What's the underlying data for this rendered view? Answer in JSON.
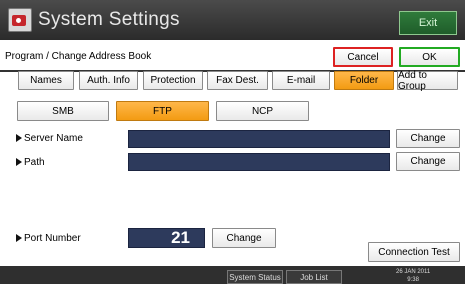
{
  "header": {
    "title": "System Settings",
    "exit_label": "Exit"
  },
  "sub_header": {
    "page_label": "Program / Change Address Book",
    "cancel_label": "Cancel",
    "ok_label": "OK"
  },
  "tabs": {
    "items": [
      {
        "label": "Names"
      },
      {
        "label": "Auth. Info"
      },
      {
        "label": "Protection"
      },
      {
        "label": "Fax Dest."
      },
      {
        "label": "E-mail"
      },
      {
        "label": "Folder"
      },
      {
        "label": "Add to Group"
      }
    ],
    "selected": "Folder"
  },
  "protocol": {
    "items": [
      {
        "label": "SMB"
      },
      {
        "label": "FTP"
      },
      {
        "label": "NCP"
      }
    ],
    "selected": "FTP"
  },
  "fields": {
    "server_name": {
      "label": "Server Name",
      "value": "",
      "change_label": "Change"
    },
    "path": {
      "label": "Path",
      "value": "",
      "change_label": "Change"
    },
    "port_number": {
      "label": "Port Number",
      "value": "21",
      "change_label": "Change"
    }
  },
  "connection_test_label": "Connection Test",
  "statusbar": {
    "system_status_label": "System Status",
    "job_list_label": "Job List",
    "date": "26 JAN 2011",
    "time": "9:38"
  },
  "colors": {
    "selected_orange": "#f39b12",
    "field_navy": "#2d3a5c",
    "exit_green": "#2f7b3b"
  }
}
